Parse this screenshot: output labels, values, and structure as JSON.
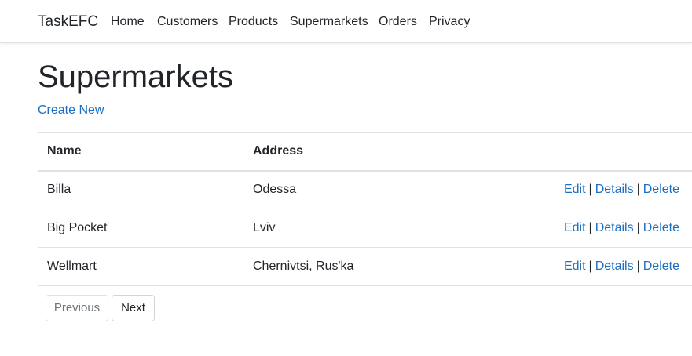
{
  "navbar": {
    "brand": "TaskEFC",
    "links": [
      {
        "label": "Home"
      },
      {
        "label": "Customers"
      },
      {
        "label": "Products"
      },
      {
        "label": "Supermarkets"
      },
      {
        "label": "Orders"
      },
      {
        "label": "Privacy"
      }
    ]
  },
  "page": {
    "title": "Supermarkets",
    "create_label": "Create New"
  },
  "table": {
    "headers": [
      "Name",
      "Address",
      ""
    ],
    "rows": [
      {
        "name": "Billa",
        "address": "Odessa"
      },
      {
        "name": "Big Pocket",
        "address": "Lviv"
      },
      {
        "name": "Wellmart",
        "address": "Chernivtsi, Rus'ka"
      }
    ],
    "actions": {
      "edit": "Edit",
      "details": "Details",
      "delete": "Delete",
      "separator": "|"
    }
  },
  "pager": {
    "previous_label": "Previous",
    "next_label": "Next",
    "previous_disabled": true
  },
  "colors": {
    "link": "#1b6ec2",
    "text": "#212529",
    "border": "#dee2e6"
  }
}
